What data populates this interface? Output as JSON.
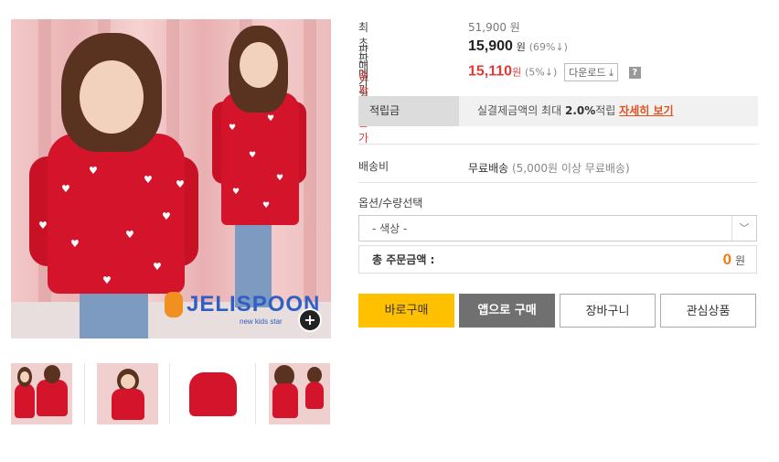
{
  "brand": {
    "logo_text": "JELISPOON",
    "logo_sub": "new kids star"
  },
  "zoom_icon": "+",
  "prices": {
    "original_label": "최초판매가격",
    "original_value": "51,900 원",
    "sale_label": "판매가격",
    "sale_value": "15,900",
    "sale_unit": "원",
    "sale_discount": "(69%↓)",
    "coupon_label": "중복쿠폰가",
    "coupon_value": "15,110",
    "coupon_unit": "원",
    "coupon_discount": "(5%↓)",
    "download_label": "다운로드",
    "help_label": "?"
  },
  "points": {
    "label": "적립금",
    "text_prefix": "실결제금액의 최대",
    "rate": "2.0%",
    "text_suffix": "적립",
    "link": "자세히 보기"
  },
  "shipping": {
    "label": "배송비",
    "value": "무료배송",
    "note": "(5,000원 이상 무료배송)"
  },
  "options": {
    "label": "옵션/수량선택",
    "select_value": "- 색상 -"
  },
  "total": {
    "label": "총 주문금액 :",
    "amount": "0",
    "unit": "원"
  },
  "buttons": {
    "buy_now": "바로구매",
    "app_buy": "앱으로 구매",
    "cart": "장바구니",
    "wishlist": "관심상품"
  },
  "colors": {
    "accent": "#ffc000",
    "coupon_red": "#e03a3a",
    "link_orange": "#e0521e",
    "total_orange": "#f07c12"
  }
}
